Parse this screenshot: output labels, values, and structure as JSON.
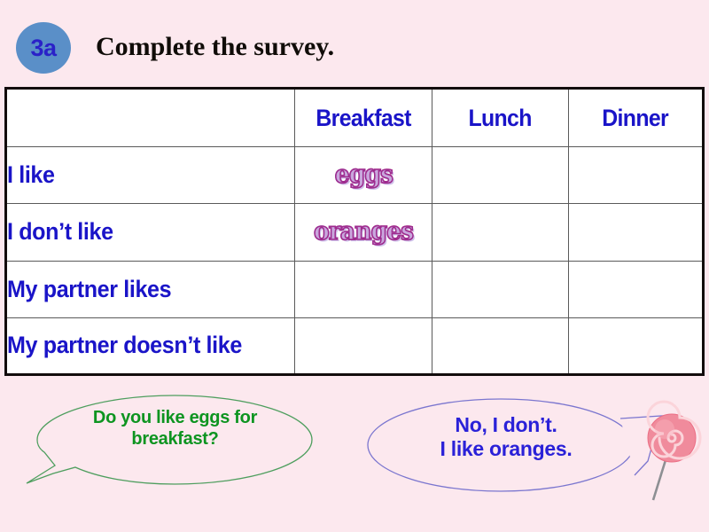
{
  "header": {
    "badge_label": "3a",
    "title": "Complete the survey."
  },
  "table": {
    "columns": [
      "",
      "Breakfast",
      "Lunch",
      "Dinner"
    ],
    "rows": [
      {
        "label": "I like",
        "breakfast": "eggs",
        "lunch": "",
        "dinner": ""
      },
      {
        "label": "I don’t like",
        "breakfast": "oranges",
        "lunch": "",
        "dinner": ""
      },
      {
        "label": "My partner likes",
        "breakfast": "",
        "lunch": "",
        "dinner": ""
      },
      {
        "label": "My partner doesn’t like",
        "breakfast": "",
        "lunch": "",
        "dinner": ""
      }
    ]
  },
  "bubbles": {
    "left": {
      "text": "Do you like eggs for\nbreakfast?",
      "color": "#0d9420"
    },
    "right": {
      "text": "No, I don’t.\nI like oranges.",
      "color": "#2a21d8"
    }
  },
  "decoration": {
    "lollipop": "lollipop-icon"
  },
  "colors": {
    "background": "#fce8ee",
    "badge_fill": "#5a8fc8",
    "badge_text": "#2a21c8",
    "table_text": "#1a14c8",
    "table_border": "#120c0c",
    "bubble_left_outline": "#4e9e5e",
    "bubble_right_outline": "#7b76cf",
    "lollipop": "#ef7a8e"
  }
}
